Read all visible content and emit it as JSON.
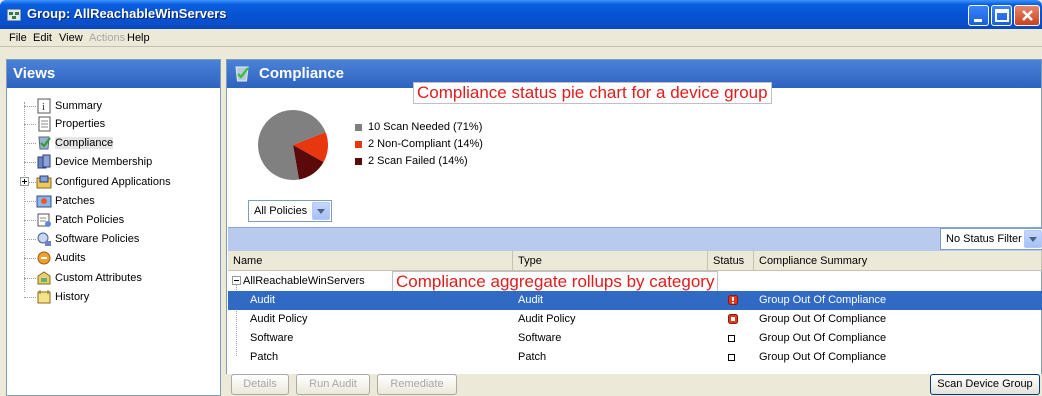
{
  "window": {
    "title": "Group: AllReachableWinServers"
  },
  "menu": [
    {
      "label": "File",
      "enabled": true
    },
    {
      "label": "Edit",
      "enabled": true
    },
    {
      "label": "View",
      "enabled": true
    },
    {
      "label": "Actions",
      "enabled": false
    },
    {
      "label": "Help",
      "enabled": true
    }
  ],
  "views": {
    "header": "Views",
    "items": [
      {
        "label": "Summary",
        "icon": "summary-icon"
      },
      {
        "label": "Properties",
        "icon": "properties-icon"
      },
      {
        "label": "Compliance",
        "icon": "compliance-icon",
        "selected": true
      },
      {
        "label": "Device Membership",
        "icon": "device-membership-icon"
      },
      {
        "label": "Configured Applications",
        "icon": "configured-applications-icon"
      },
      {
        "label": "Patches",
        "icon": "patches-icon"
      },
      {
        "label": "Patch Policies",
        "icon": "patch-policies-icon"
      },
      {
        "label": "Software Policies",
        "icon": "software-policies-icon"
      },
      {
        "label": "Audits",
        "icon": "audits-icon"
      },
      {
        "label": "Custom Attributes",
        "icon": "custom-attributes-icon"
      },
      {
        "label": "History",
        "icon": "history-icon"
      }
    ]
  },
  "compliance": {
    "header": "Compliance",
    "annotation_top": "Compliance status pie chart for a device group",
    "annotation_table": "Compliance aggregate rollups by category",
    "legend": [
      {
        "label": "10 Scan Needed (71%)",
        "color": "#808080",
        "value": 71
      },
      {
        "label": "2 Non-Compliant (14%)",
        "color": "#e8360e",
        "value": 14
      },
      {
        "label": "2 Scan Failed (14%)",
        "color": "#5a0a0a",
        "value": 14
      }
    ],
    "policy_select": "All Policies",
    "status_filter": "No Status Filter",
    "columns": {
      "name": "Name",
      "type": "Type",
      "status": "Status",
      "summary": "Compliance Summary"
    },
    "group_row": "AllReachableWinServers",
    "rows": [
      {
        "name": "Audit",
        "type": "Audit",
        "summary": "Group Out Of Compliance",
        "selected": true
      },
      {
        "name": "Audit Policy",
        "type": "Audit Policy",
        "summary": "Group Out Of Compliance"
      },
      {
        "name": "Software",
        "type": "Software",
        "summary": "Group Out Of Compliance"
      },
      {
        "name": "Patch",
        "type": "Patch",
        "summary": "Group Out Of Compliance"
      }
    ]
  },
  "buttons": {
    "details": "Details",
    "run_audit": "Run Audit",
    "remediate": "Remediate",
    "scan_device_group": "Scan Device Group"
  }
}
